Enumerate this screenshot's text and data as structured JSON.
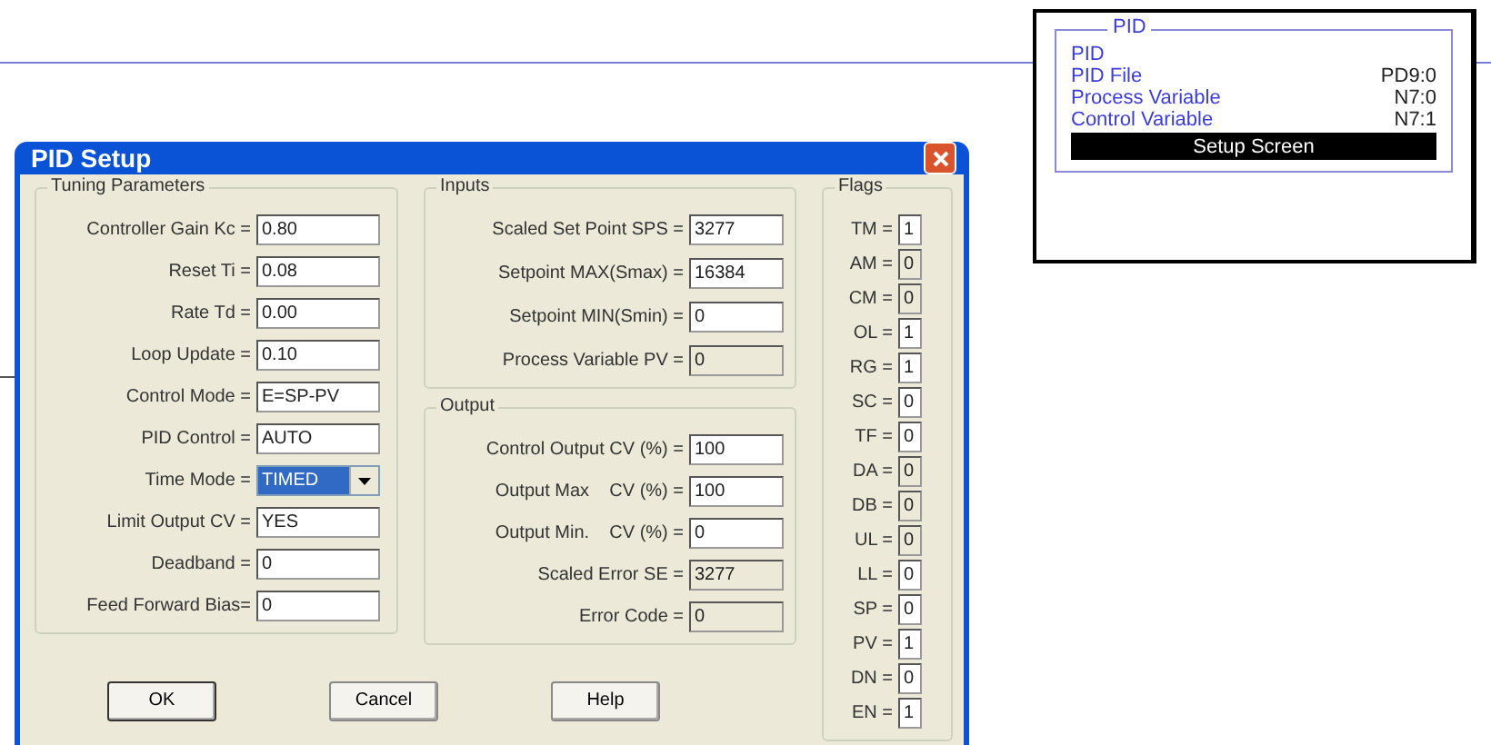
{
  "dialog": {
    "title": "PID Setup",
    "tuning": {
      "title": "Tuning Parameters",
      "fields": [
        {
          "label": "Controller Gain Kc =",
          "value": "0.80",
          "kind": "text",
          "readonly": false
        },
        {
          "label": "Reset Ti =",
          "value": "0.08",
          "kind": "text",
          "readonly": false
        },
        {
          "label": "Rate Td =",
          "value": "0.00",
          "kind": "text",
          "readonly": false
        },
        {
          "label": "Loop Update =",
          "value": "0.10",
          "kind": "text",
          "readonly": false
        },
        {
          "label": "Control Mode =",
          "value": "E=SP-PV",
          "kind": "text",
          "readonly": false
        },
        {
          "label": "PID Control =",
          "value": "AUTO",
          "kind": "text",
          "readonly": false
        },
        {
          "label": "Time Mode =",
          "value": "TIMED",
          "kind": "dropdown",
          "highlighted": true
        },
        {
          "label": "Limit Output CV =",
          "value": "YES",
          "kind": "text",
          "readonly": false
        },
        {
          "label": "Deadband =",
          "value": "0",
          "kind": "text",
          "readonly": false
        },
        {
          "label": "Feed Forward Bias=",
          "value": "0",
          "kind": "text",
          "readonly": false
        }
      ]
    },
    "inputs": {
      "title": "Inputs",
      "fields": [
        {
          "label": "Scaled Set Point SPS =",
          "value": "3277",
          "readonly": false
        },
        {
          "label": "Setpoint MAX(Smax) =",
          "value": "16384",
          "readonly": false
        },
        {
          "label": "Setpoint MIN(Smin) =",
          "value": "0",
          "readonly": false
        },
        {
          "label": "Process Variable PV =",
          "value": "0",
          "readonly": true
        }
      ]
    },
    "output": {
      "title": "Output",
      "fields": [
        {
          "label": "Control Output CV (%) =",
          "value": "100",
          "readonly": false
        },
        {
          "label": "Output Max    CV (%) =",
          "value": "100",
          "readonly": false
        },
        {
          "label": "Output Min.    CV (%) =",
          "value": "0",
          "readonly": false
        },
        {
          "label": "Scaled Error SE =",
          "value": "3277",
          "readonly": true
        },
        {
          "label": "Error Code =",
          "value": "0",
          "readonly": true
        }
      ]
    },
    "flags": {
      "title": "Flags",
      "items": [
        {
          "label": "TM =",
          "value": "1",
          "readonly": false
        },
        {
          "label": "AM =",
          "value": "0",
          "readonly": true
        },
        {
          "label": "CM =",
          "value": "0",
          "readonly": true
        },
        {
          "label": "OL =",
          "value": "1",
          "readonly": false
        },
        {
          "label": "RG =",
          "value": "1",
          "readonly": false
        },
        {
          "label": "SC =",
          "value": "0",
          "readonly": false
        },
        {
          "label": "TF =",
          "value": "0",
          "readonly": false
        },
        {
          "label": "DA =",
          "value": "0",
          "readonly": true
        },
        {
          "label": "DB =",
          "value": "0",
          "readonly": true
        },
        {
          "label": "UL =",
          "value": "0",
          "readonly": true
        },
        {
          "label": "LL =",
          "value": "0",
          "readonly": false
        },
        {
          "label": "SP =",
          "value": "0",
          "readonly": false
        },
        {
          "label": "PV =",
          "value": "1",
          "readonly": false
        },
        {
          "label": "DN =",
          "value": "0",
          "readonly": false
        },
        {
          "label": "EN =",
          "value": "1",
          "readonly": false
        }
      ]
    },
    "buttons": [
      {
        "label": "OK",
        "default": true
      },
      {
        "label": "Cancel",
        "default": false
      },
      {
        "label": "Help",
        "default": false
      }
    ]
  },
  "pid_block": {
    "title": "PID",
    "rows": [
      {
        "label": "PID"
      },
      {
        "label": "PID File",
        "value": "PD9:0"
      },
      {
        "label": "Process Variable",
        "value": "N7:0"
      },
      {
        "label": "Control Variable",
        "value": "N7:1"
      }
    ],
    "button": "Setup Screen"
  }
}
